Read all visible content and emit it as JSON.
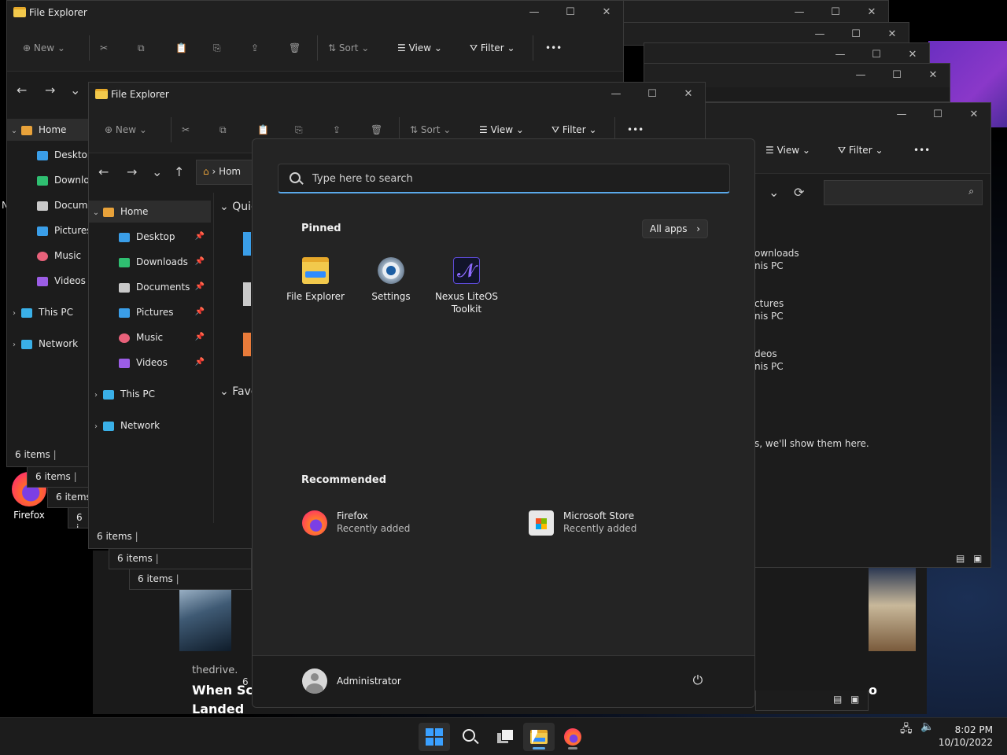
{
  "window": {
    "title": "File Explorer",
    "status": "6 items",
    "status_short": "6 i",
    "controls": {
      "minimize": "—",
      "maximize": "☐",
      "close": "✕"
    }
  },
  "toolbar": {
    "new": "New",
    "sort": "Sort",
    "view": "View",
    "filter": "Filter",
    "more": "•••"
  },
  "address": {
    "home_short": "Hom"
  },
  "sidebar": {
    "home": "Home",
    "desktop": "Desktop",
    "downloads": "Downloads",
    "documents": "Documents",
    "pictures": "Pictures",
    "music": "Music",
    "videos": "Videos",
    "this_pc": "This PC",
    "network": "Network",
    "downloads_trunc": "Downloa",
    "documents_trunc": "Docume"
  },
  "explorer_content": {
    "quick": "Quic",
    "favorites": "Favo",
    "right_items": [
      {
        "name": "ownloads",
        "loc": "nis PC"
      },
      {
        "name": "ctures",
        "loc": "nis PC"
      },
      {
        "name": "deos",
        "loc": "nis PC"
      }
    ],
    "empty_hint": "s, we'll show them here."
  },
  "desktop": {
    "firefox_label": "Firefox",
    "stray_letter": "N"
  },
  "background_page": {
    "source": "thedrive.",
    "title": "When Sc Landed At",
    "fragment": "o"
  },
  "start_menu": {
    "search_placeholder": "Type here to search",
    "pinned_title": "Pinned",
    "all_apps": "All apps",
    "pinned": [
      {
        "label": "File Explorer",
        "icon": "folder-icon"
      },
      {
        "label": "Settings",
        "icon": "gear-icon"
      },
      {
        "label": "Nexus LiteOS Toolkit",
        "icon": "nexus-icon"
      }
    ],
    "recommended_title": "Recommended",
    "recommended": [
      {
        "title": "Firefox",
        "subtitle": "Recently added",
        "icon": "firefox-icon"
      },
      {
        "title": "Microsoft Store",
        "subtitle": "Recently added",
        "icon": "store-icon"
      }
    ],
    "user": "Administrator",
    "power": "⏻"
  },
  "taskbar": {
    "clock_time": "8:02 PM",
    "clock_date": "10/10/2022"
  }
}
